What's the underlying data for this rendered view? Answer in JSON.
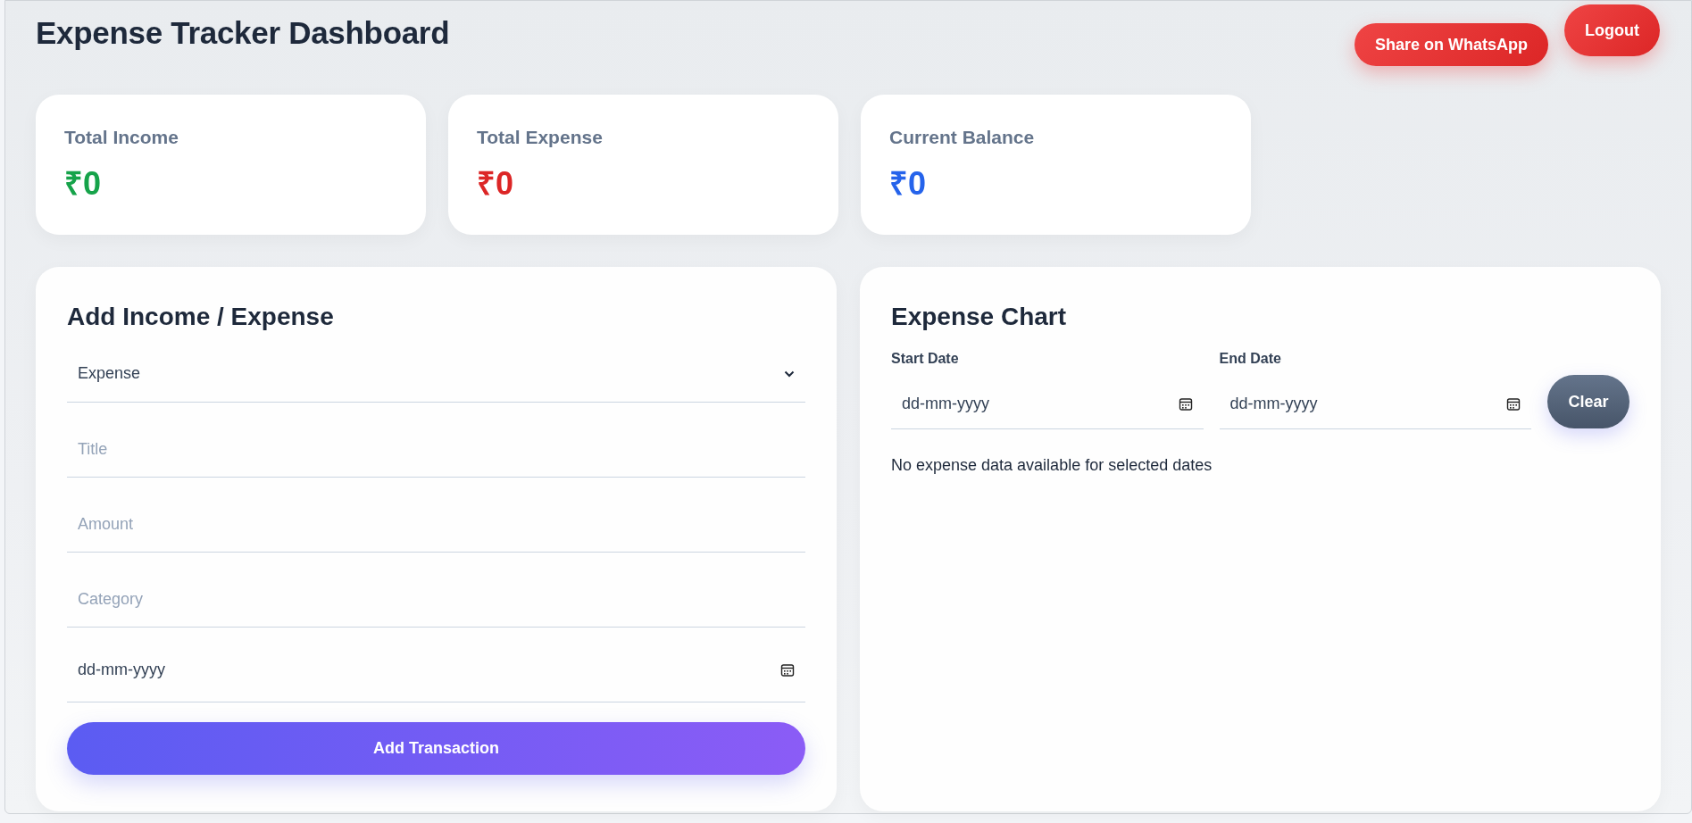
{
  "header": {
    "title": "Expense Tracker Dashboard",
    "buttons": [
      {
        "label": "Share on WhatsApp",
        "kind": "share"
      },
      {
        "label": "Logout",
        "kind": "logout"
      }
    ]
  },
  "summary_cards": [
    {
      "label": "Total Income",
      "value": "₹0",
      "color": "#16a34a"
    },
    {
      "label": "Total Expense",
      "value": "₹0",
      "color": "#dc2626"
    },
    {
      "label": "Current Balance",
      "value": "₹0",
      "color": "#2563eb"
    }
  ],
  "form": {
    "title": "Add Income / Expense",
    "type_select": {
      "value": "Expense"
    },
    "fields": [
      {
        "kind": "text",
        "placeholder": "Title"
      },
      {
        "kind": "text",
        "placeholder": "Amount"
      },
      {
        "kind": "text",
        "placeholder": "Category"
      },
      {
        "kind": "date",
        "value": "dd-mm-yyyy"
      }
    ],
    "submit": "Add Transaction"
  },
  "chart_panel": {
    "title": "Expense Chart",
    "filters": [
      {
        "label": "Start Date",
        "value": "dd-mm-yyyy"
      },
      {
        "label": "End Date",
        "value": "dd-mm-yyyy"
      }
    ],
    "clear_button": "Clear",
    "message": "No expense data available for selected dates"
  }
}
